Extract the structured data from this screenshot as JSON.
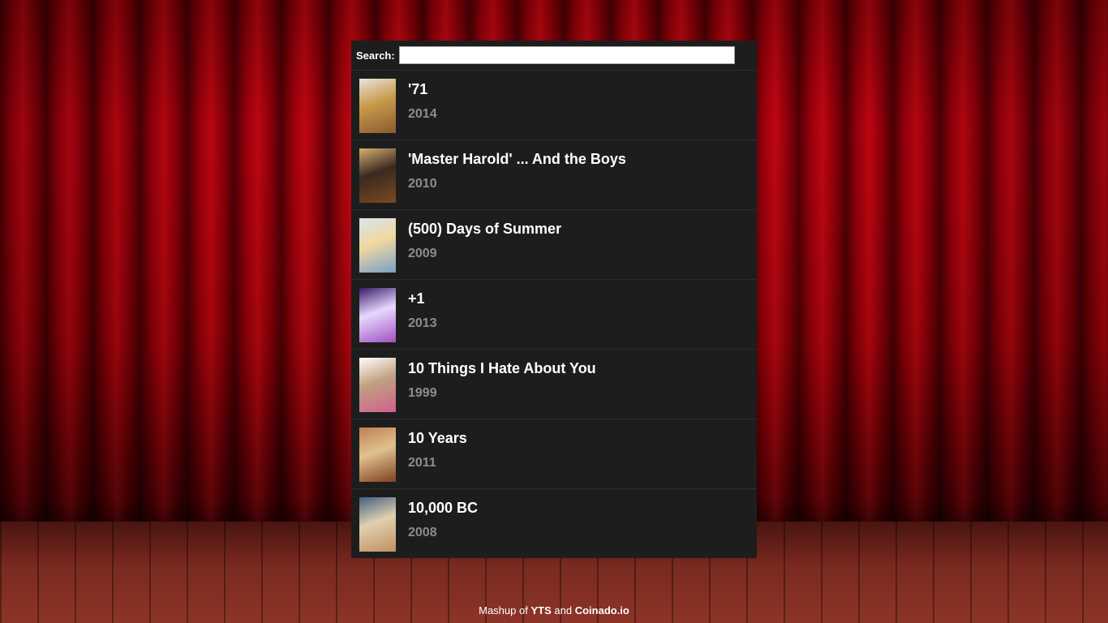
{
  "search": {
    "label": "Search:",
    "value": "",
    "placeholder": ""
  },
  "movies": [
    {
      "title": "'71",
      "year": "2014",
      "poster_colors": [
        "#e8e4dc",
        "#8a5a30",
        "#c89a4a"
      ]
    },
    {
      "title": "'Master Harold' ... And the Boys",
      "year": "2010",
      "poster_colors": [
        "#d8b070",
        "#7a4a20",
        "#3a2a20"
      ]
    },
    {
      "title": "(500) Days of Summer",
      "year": "2009",
      "poster_colors": [
        "#d8e4ee",
        "#7aa0c8",
        "#f0d8a0"
      ]
    },
    {
      "title": "+1",
      "year": "2013",
      "poster_colors": [
        "#3a1a6a",
        "#a050c0",
        "#e8d8ff"
      ]
    },
    {
      "title": "10 Things I Hate About You",
      "year": "1999",
      "poster_colors": [
        "#ffffff",
        "#d06090",
        "#c0a080"
      ]
    },
    {
      "title": "10 Years",
      "year": "2011",
      "poster_colors": [
        "#c08050",
        "#804020",
        "#e0c090"
      ]
    },
    {
      "title": "10,000 BC",
      "year": "2008",
      "poster_colors": [
        "#406080",
        "#c09060",
        "#e0d0b0"
      ]
    }
  ],
  "footer": {
    "prefix": "Mashup of",
    "link1": "YTS",
    "and": "and",
    "link2": "Coinado.io"
  }
}
